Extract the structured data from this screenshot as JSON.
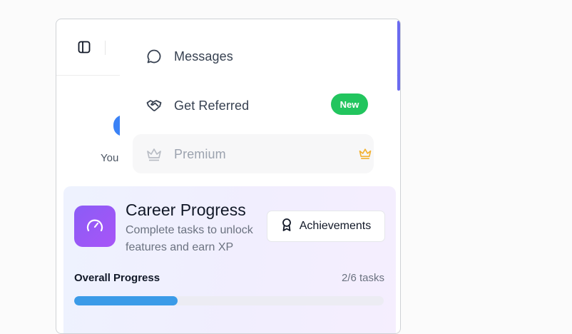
{
  "background": {
    "you_text": "You"
  },
  "menu": {
    "items": [
      {
        "label": "Messages",
        "icon": "chat-bubble-icon"
      },
      {
        "label": "Get Referred",
        "icon": "handshake-icon",
        "badge": "New"
      },
      {
        "label": "Premium",
        "icon": "crown-icon",
        "disabled": true
      }
    ]
  },
  "career": {
    "title": "Career Progress",
    "subtitle": "Complete tasks to unlock features and earn XP",
    "achievements_label": "Achievements",
    "progress_label": "Overall Progress",
    "progress_count": "2/6 tasks",
    "progress_fraction": 0.3333
  },
  "colors": {
    "badge_green": "#22c55e",
    "accent_purple": "#8b5cf6",
    "progress_blue": "#3b9be8",
    "premium_gold": "#f2b233"
  }
}
